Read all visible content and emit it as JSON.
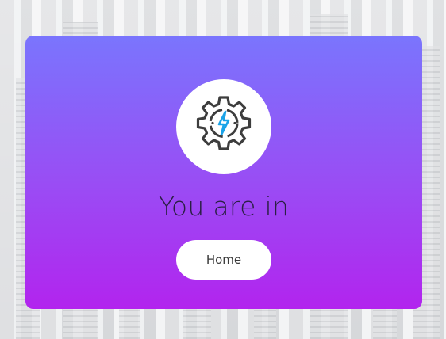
{
  "card": {
    "icon": "gear-lightning-icon",
    "title": "You are in",
    "home_button_label": "Home"
  },
  "colors": {
    "gradient_top": "#7a75fd",
    "gradient_bottom": "#b224ee",
    "icon_gear": "#3d3d3d",
    "icon_bolt": "#1aa3e8",
    "title_text": "#2a1f44"
  }
}
